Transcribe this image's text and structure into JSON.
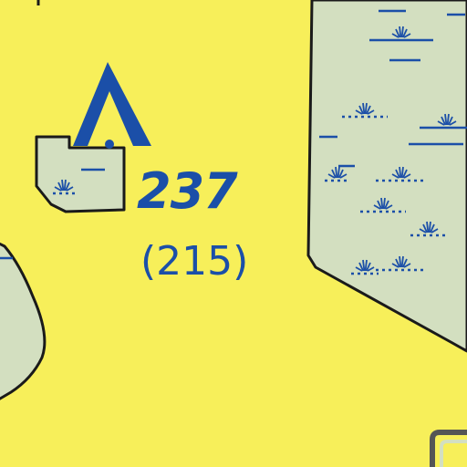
{
  "map": {
    "colors": {
      "land": "#f7ef5a",
      "marsh": "#d3dfc0",
      "symbol": "#1b4fa8",
      "outline": "#1a1a1a"
    },
    "elevation": {
      "value": "237",
      "alternate": "(215)"
    },
    "symbols": {
      "summit": "summit-triangle-icon",
      "marsh": "marsh-tuft-icon"
    }
  }
}
